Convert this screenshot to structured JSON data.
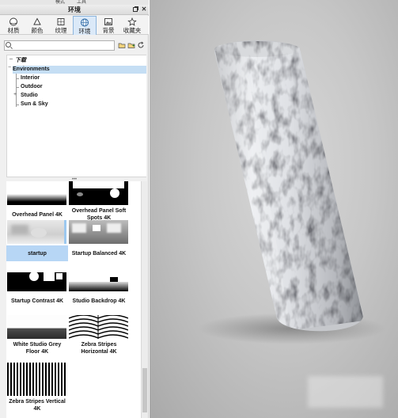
{
  "menubar": {
    "items": [
      "模式",
      "工具"
    ]
  },
  "window": {
    "title": "环境"
  },
  "tabs": [
    {
      "label": "材质",
      "icon": "sphere-icon"
    },
    {
      "label": "颜色",
      "icon": "color-drop-icon"
    },
    {
      "label": "纹理",
      "icon": "texture-icon"
    },
    {
      "label": "环境",
      "icon": "globe-icon"
    },
    {
      "label": "背景",
      "icon": "background-image-icon"
    },
    {
      "label": "收藏夹",
      "icon": "star-icon"
    }
  ],
  "active_tab": "环境",
  "search": {
    "value": "",
    "placeholder": ""
  },
  "tree": {
    "root": "下载",
    "selected": "Environments",
    "children": [
      "Interior",
      "Outdoor",
      "Studio",
      "Sun & Sky"
    ]
  },
  "thumbnails": [
    {
      "label": "Overhead Panel 4K"
    },
    {
      "label": "Overhead Panel Soft Spots 4K"
    },
    {
      "label": "startup",
      "selected": true
    },
    {
      "label": "Startup Balanced 4K"
    },
    {
      "label": "Startup Contrast 4K"
    },
    {
      "label": "Studio Backdrop 4K"
    },
    {
      "label": "White Studio Grey Floor 4K"
    },
    {
      "label": "Zebra Stripes Horizontal 4K"
    },
    {
      "label": "Zebra Stripes Vertical 4K"
    }
  ],
  "viewport": {
    "object": "cylinder with crumpled foil texture"
  }
}
